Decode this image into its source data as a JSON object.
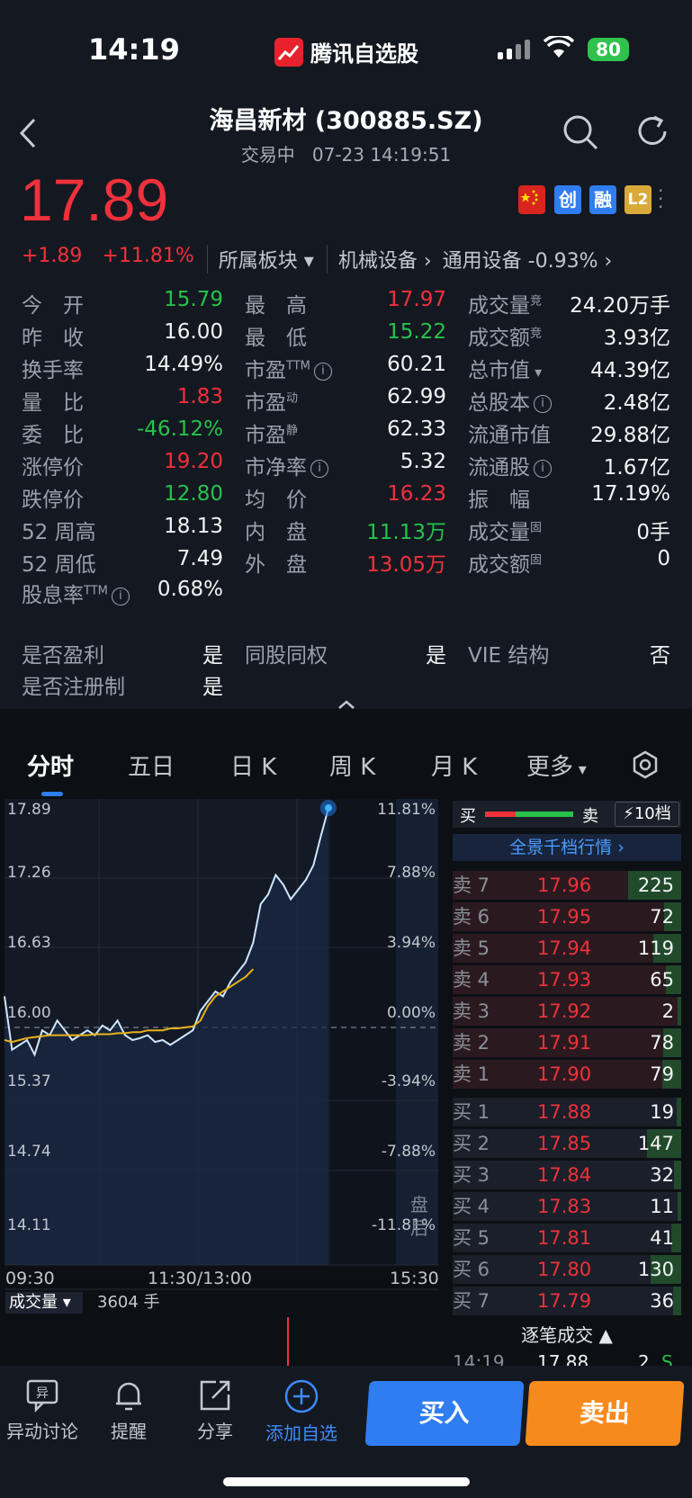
{
  "status": {
    "time": "14:19",
    "app_name": "腾讯自选股",
    "battery": "80"
  },
  "header": {
    "title": "海昌新材 (300885.SZ)",
    "status": "交易中",
    "datetime": "07-23 14:19:51"
  },
  "quote": {
    "price": "17.89",
    "change": "+1.89",
    "change_pct": "+11.81%",
    "sector_label": "所属板块",
    "sector1": "机械设备",
    "sector2": "通用设备",
    "sector2_pct": "-0.93%",
    "tags": [
      "创",
      "融",
      "L2"
    ]
  },
  "stats": {
    "col1": [
      {
        "label": "今　开",
        "value": "15.79",
        "color": "green"
      },
      {
        "label": "昨　收",
        "value": "16.00",
        "color": "white"
      },
      {
        "label": "换手率",
        "value": "14.49%",
        "color": "white"
      },
      {
        "label": "量　比",
        "value": "1.83",
        "color": "red"
      },
      {
        "label": "委　比",
        "value": "-46.12%",
        "color": "green"
      },
      {
        "label": "涨停价",
        "value": "19.20",
        "color": "red"
      },
      {
        "label": "跌停价",
        "value": "12.80",
        "color": "green"
      },
      {
        "label": "52 周高",
        "value": "18.13",
        "color": "white"
      },
      {
        "label": "52 周低",
        "value": "7.49",
        "color": "white"
      }
    ],
    "col2": [
      {
        "label": "最　高",
        "value": "17.97",
        "color": "red"
      },
      {
        "label": "最　低",
        "value": "15.22",
        "color": "green"
      },
      {
        "label": "市盈",
        "sup": "TTM",
        "value": "60.21",
        "color": "white",
        "info": true
      },
      {
        "label": "市盈",
        "sup": "动",
        "value": "62.99",
        "color": "white"
      },
      {
        "label": "市盈",
        "sup": "静",
        "value": "62.33",
        "color": "white"
      },
      {
        "label": "市净率",
        "value": "5.32",
        "color": "white",
        "info": true
      },
      {
        "label": "均　价",
        "value": "16.23",
        "color": "red"
      },
      {
        "label": "内　盘",
        "value": "11.13万",
        "color": "green"
      },
      {
        "label": "外　盘",
        "value": "13.05万",
        "color": "red"
      }
    ],
    "col3": [
      {
        "label": "成交量",
        "sup": "竞",
        "value": "24.20万手"
      },
      {
        "label": "成交额",
        "sup": "竞",
        "value": "3.93亿"
      },
      {
        "label": "总市值",
        "value": "44.39亿",
        "caret": true
      },
      {
        "label": "总股本",
        "value": "2.48亿",
        "info": true
      },
      {
        "label": "流通市值",
        "value": "29.88亿"
      },
      {
        "label": "流通股",
        "value": "1.67亿",
        "info": true
      },
      {
        "label": "振　幅",
        "value": "17.19%"
      },
      {
        "label": "成交量",
        "sup": "固",
        "value": "0手"
      },
      {
        "label": "成交额",
        "sup": "固",
        "value": "0"
      }
    ],
    "dividend_label": "股息率",
    "dividend_sup": "TTM",
    "dividend_value": "0.68%"
  },
  "flags": [
    {
      "label": "是否盈利",
      "value": "是"
    },
    {
      "label": "同股同权",
      "value": "是"
    },
    {
      "label": "VIE 结构",
      "value": "否"
    },
    {
      "label": "是否注册制",
      "value": "是"
    }
  ],
  "tabs": [
    "分时",
    "五日",
    "日 K",
    "周 K",
    "月 K",
    "更多"
  ],
  "chart": {
    "price_ticks": [
      "17.89",
      "17.26",
      "16.63",
      "16.00",
      "15.37",
      "14.74",
      "14.11"
    ],
    "pct_ticks": [
      "11.81%",
      "7.88%",
      "3.94%",
      "0.00%",
      "-3.94%",
      "-7.88%",
      "-11.81%"
    ],
    "time_ticks": [
      "09:30",
      "11:30/13:00",
      "15:30"
    ],
    "after_hours": "盘后",
    "volume_label": "成交量",
    "volume_value": "3604 手"
  },
  "chart_data": {
    "type": "line",
    "ylim": [
      14.11,
      17.89
    ],
    "series": [
      {
        "values": [
          15.95,
          15.4,
          15.45,
          15.5,
          15.35,
          15.6,
          15.55,
          15.7,
          15.6,
          15.5,
          15.55,
          15.6,
          15.55,
          15.65,
          15.6,
          15.7,
          15.55,
          15.5,
          15.52,
          15.55,
          15.48,
          15.5,
          15.45,
          15.5,
          15.55,
          15.6,
          15.8,
          15.9,
          16.0,
          15.95,
          16.1,
          16.2,
          16.3,
          16.5,
          16.9,
          17.0,
          17.2,
          17.1,
          16.95,
          17.05,
          17.15,
          17.3,
          17.6,
          17.89
        ]
      },
      {
        "values": [
          15.5,
          15.48,
          15.5,
          15.52,
          15.53,
          15.54,
          15.55,
          15.55,
          15.55,
          15.55,
          15.55,
          15.55,
          15.56,
          15.56,
          15.56,
          15.57,
          15.57,
          15.58,
          15.58,
          15.6,
          15.6,
          15.6,
          15.62,
          15.62,
          15.63,
          15.64,
          15.7,
          15.85,
          15.95,
          16.0,
          16.05,
          16.1,
          16.15,
          16.23
        ]
      }
    ]
  },
  "orderbook": {
    "buy_label": "买",
    "sell_label": "卖",
    "depth_label": "10档",
    "panorama": "全景千档行情",
    "asks": [
      {
        "label": "卖 7",
        "price": "17.96",
        "vol": "225"
      },
      {
        "label": "卖 6",
        "price": "17.95",
        "vol": "72"
      },
      {
        "label": "卖 5",
        "price": "17.94",
        "vol": "119"
      },
      {
        "label": "卖 4",
        "price": "17.93",
        "vol": "65"
      },
      {
        "label": "卖 3",
        "price": "17.92",
        "vol": "2"
      },
      {
        "label": "卖 2",
        "price": "17.91",
        "vol": "78"
      },
      {
        "label": "卖 1",
        "price": "17.90",
        "vol": "79"
      }
    ],
    "bids": [
      {
        "label": "买 1",
        "price": "17.88",
        "vol": "19"
      },
      {
        "label": "买 2",
        "price": "17.85",
        "vol": "147"
      },
      {
        "label": "买 3",
        "price": "17.84",
        "vol": "32"
      },
      {
        "label": "买 4",
        "price": "17.83",
        "vol": "11"
      },
      {
        "label": "买 5",
        "price": "17.81",
        "vol": "41"
      },
      {
        "label": "买 6",
        "price": "17.80",
        "vol": "130"
      },
      {
        "label": "买 7",
        "price": "17.79",
        "vol": "36"
      }
    ],
    "trades_label": "逐笔成交",
    "last_trade": {
      "time": "14:19",
      "price": "17.88",
      "vol": "2",
      "side": "S"
    }
  },
  "bottom": {
    "items": [
      "异动讨论",
      "提醒",
      "分享",
      "添加自选"
    ],
    "buy": "买入",
    "sell": "卖出"
  },
  "colors": {
    "up": "#f0313c",
    "down": "#27c24c",
    "accent": "#2f7df0",
    "sell": "#f78a1c"
  }
}
